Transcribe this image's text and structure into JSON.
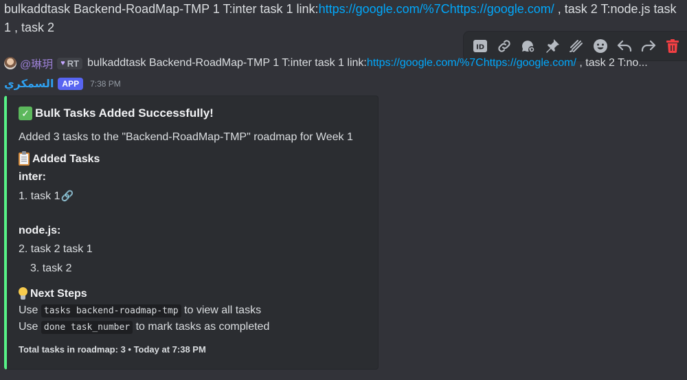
{
  "previous_message": {
    "text_before_link": "bulkaddtask Backend-RoadMap-TMP 1 T:inter task 1 link:",
    "link": "https://google.com/%7Chttps://google.com/",
    "text_after_link": " , task 2 T:node.js task 1 , task 2"
  },
  "toolbar": {
    "icons": [
      "id-icon",
      "link-icon",
      "thread-icon",
      "pin-icon",
      "reactions-icon",
      "emoji-icon",
      "reply-icon",
      "forward-icon",
      "trash-icon"
    ],
    "trash_color": "#f23f43"
  },
  "reply": {
    "name": "@琳玥",
    "role": "RT",
    "text_before_link": "bulkaddtask Backend-RoadMap-TMP 1 T:inter task 1 link:",
    "link": "https://google.com/%7Chttps://google.com/",
    "text_after_link": " , task 2 T:no..."
  },
  "message": {
    "author": "السمكري",
    "badge": "APP",
    "time": "7:38 PM"
  },
  "embed": {
    "accent_color": "#57f287",
    "title": "Bulk Tasks Added Successfully!",
    "title_icon": "✓",
    "description": "Added 3 tasks to the \"Backend-RoadMap-TMP\" roadmap for Week 1",
    "added_tasks_label": "Added Tasks",
    "group1_label": "inter:",
    "group1_item": "1. task 1",
    "group2_label": "node.js:",
    "group2_item1": "2. task 2 task 1",
    "group2_item2": "3. task 2",
    "next_steps_label": "Next Steps",
    "step1_prefix": "Use",
    "step1_code": "tasks backend-roadmap-tmp",
    "step1_suffix": "to view all tasks",
    "step2_prefix": "Use",
    "step2_code": "done task_number",
    "step2_suffix": "to mark tasks as completed",
    "footer": "Total tasks in roadmap: 3 • Today at 7:38 PM"
  }
}
